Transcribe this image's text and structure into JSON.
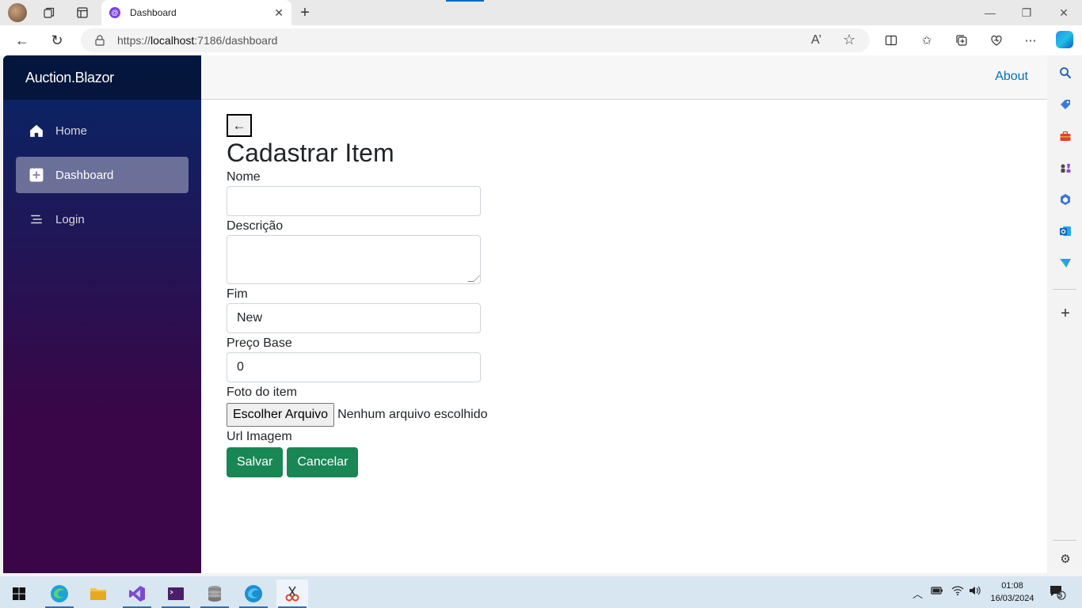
{
  "browser": {
    "tab_title": "Dashboard",
    "tab_favicon": "@",
    "url_host": "https://",
    "url_domain": "localhost",
    "url_rest": ":7186/dashboard",
    "reader_label": "A’"
  },
  "app": {
    "brand": "Auction.Blazor",
    "nav": [
      {
        "label": "Home",
        "icon": "home-icon"
      },
      {
        "label": "Dashboard",
        "icon": "plus-square-icon"
      },
      {
        "label": "Login",
        "icon": "list-icon"
      }
    ],
    "about_label": "About"
  },
  "form": {
    "back_label": "←",
    "title": "Cadastrar Item",
    "nome_label": "Nome",
    "nome_value": "",
    "descricao_label": "Descrição",
    "fim_label": "Fim",
    "fim_value": "New",
    "preco_label": "Preço Base",
    "preco_value": "0",
    "foto_label": "Foto do item",
    "file_button": "Escolher Arquivo",
    "file_status": "Nenhum arquivo escolhido",
    "url_label": "Url Imagem",
    "save_label": "Salvar",
    "cancel_label": "Cancelar"
  },
  "taskbar": {
    "time": "01:08",
    "date": "16/03/2024",
    "notification_count": "5"
  },
  "colors": {
    "accent": "#198754",
    "link": "#0071c1",
    "sidebar_top": "#052767",
    "sidebar_bottom": "#3a0647"
  }
}
